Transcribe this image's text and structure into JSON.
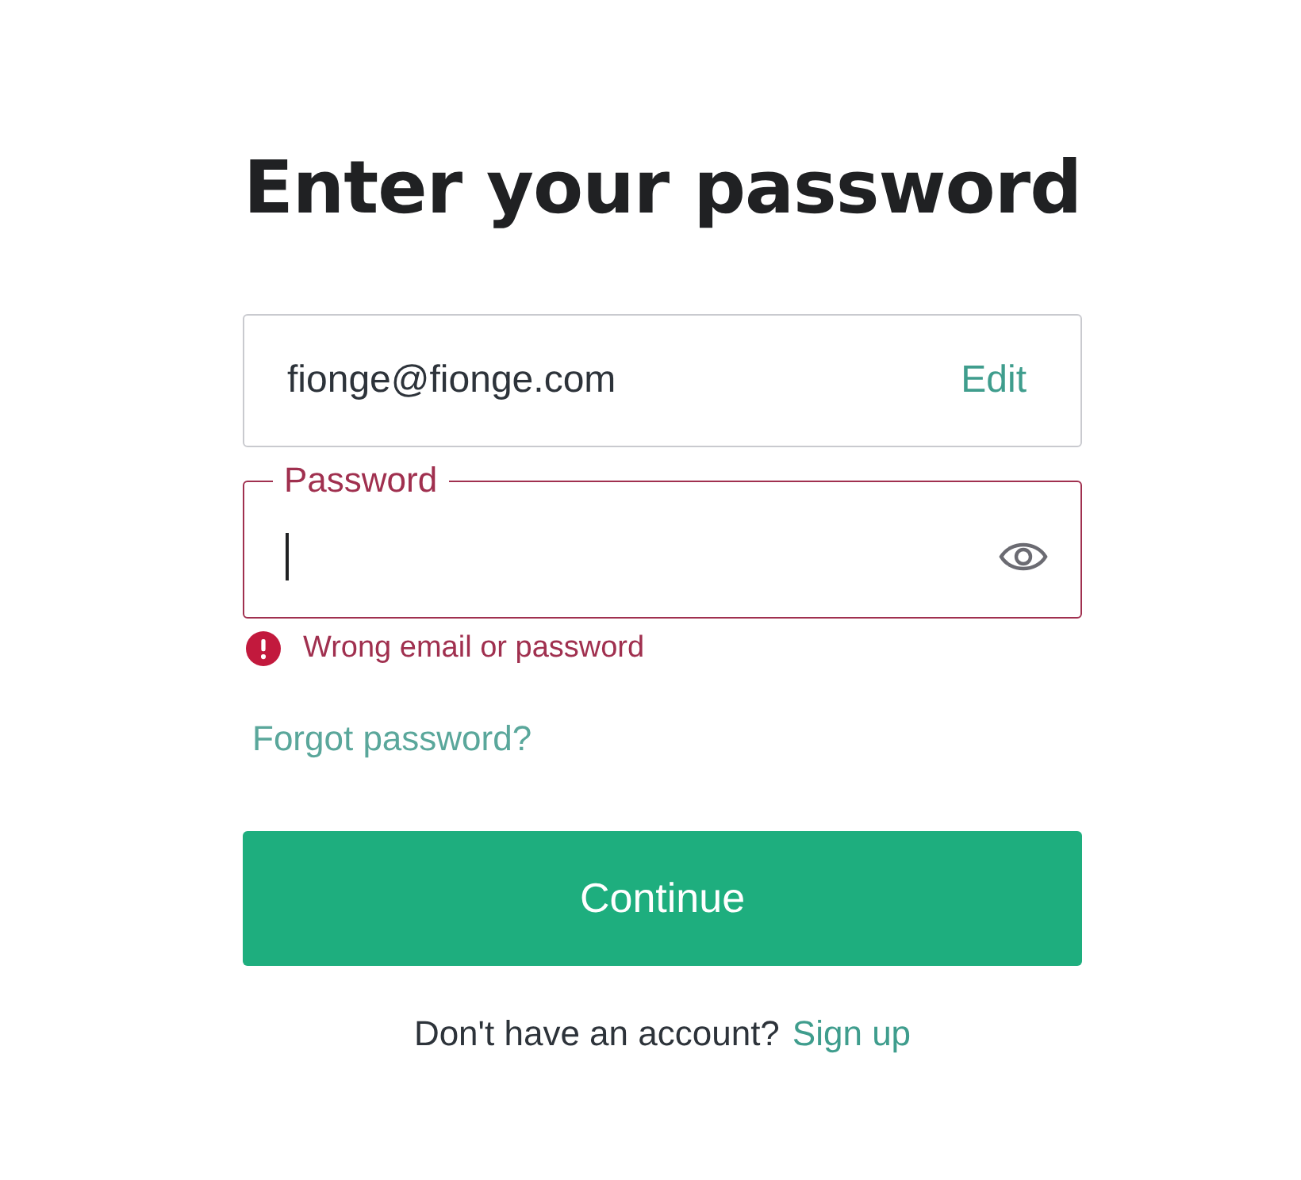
{
  "heading": "Enter your password",
  "email_field": {
    "value": "fionge@fionge.com",
    "action": "Edit"
  },
  "password_field": {
    "label": "Password",
    "error": true,
    "focused": true
  },
  "error_message": "Wrong email or password",
  "forgot_link": "Forgot password?",
  "continue_button": "Continue",
  "signup": {
    "prompt": "Don't have an account?",
    "link": "Sign up"
  }
}
